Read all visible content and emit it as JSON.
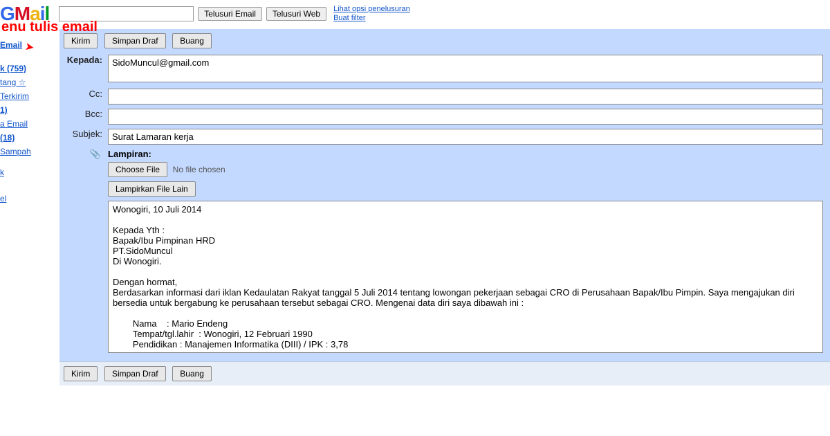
{
  "header": {
    "logo_text": "GMail",
    "search_value": "",
    "btn_search_mail": "Telusuri Email",
    "btn_search_web": "Telusuri Web",
    "link_options": "Lihat opsi penelusuran",
    "link_filter": "Buat filter"
  },
  "annotation": {
    "text": "enu tulis email"
  },
  "sidebar": {
    "compose": "Email",
    "items": [
      "k (759)",
      "tang ☆",
      "Terkirim",
      "1)",
      "a Email",
      "(18)",
      "Sampah",
      "k",
      "el"
    ]
  },
  "compose": {
    "btn_send": "Kirim",
    "btn_save": "Simpan Draf",
    "btn_discard": "Buang",
    "lbl_to": "Kepada:",
    "lbl_cc": "Cc:",
    "lbl_bcc": "Bcc:",
    "lbl_subject": "Subjek:",
    "lbl_attach": "Lampiran:",
    "btn_choose_file": "Choose File",
    "txt_no_file": "No file chosen",
    "btn_attach_more": "Lampirkan File Lain",
    "to_value": "SidoMuncul@gmail.com",
    "cc_value": "",
    "bcc_value": "",
    "subject_value": "Surat Lamaran kerja",
    "body_value": "Wonogiri, 10 Juli 2014\n\nKepada Yth :\nBapak/Ibu Pimpinan HRD\nPT.SidoMuncul\nDi Wonogiri.\n\nDengan hormat,\nBerdasarkan informasi dari iklan Kedaulatan Rakyat tanggal 5 Juli 2014 tentang lowongan pekerjaan sebagai CRO di Perusahaan Bapak/Ibu Pimpin. Saya mengajukan diri bersedia untuk bergabung ke perusahaan tersebut sebagai CRO. Mengenai data diri saya dibawah ini :\n\n        Nama    : Mario Endeng\n        Tempat/tgl.lahir  : Wonogiri, 12 Februari 1990\n        Pendidikan : Manajemen Informatika (DIII) / IPK : 3,78"
  }
}
